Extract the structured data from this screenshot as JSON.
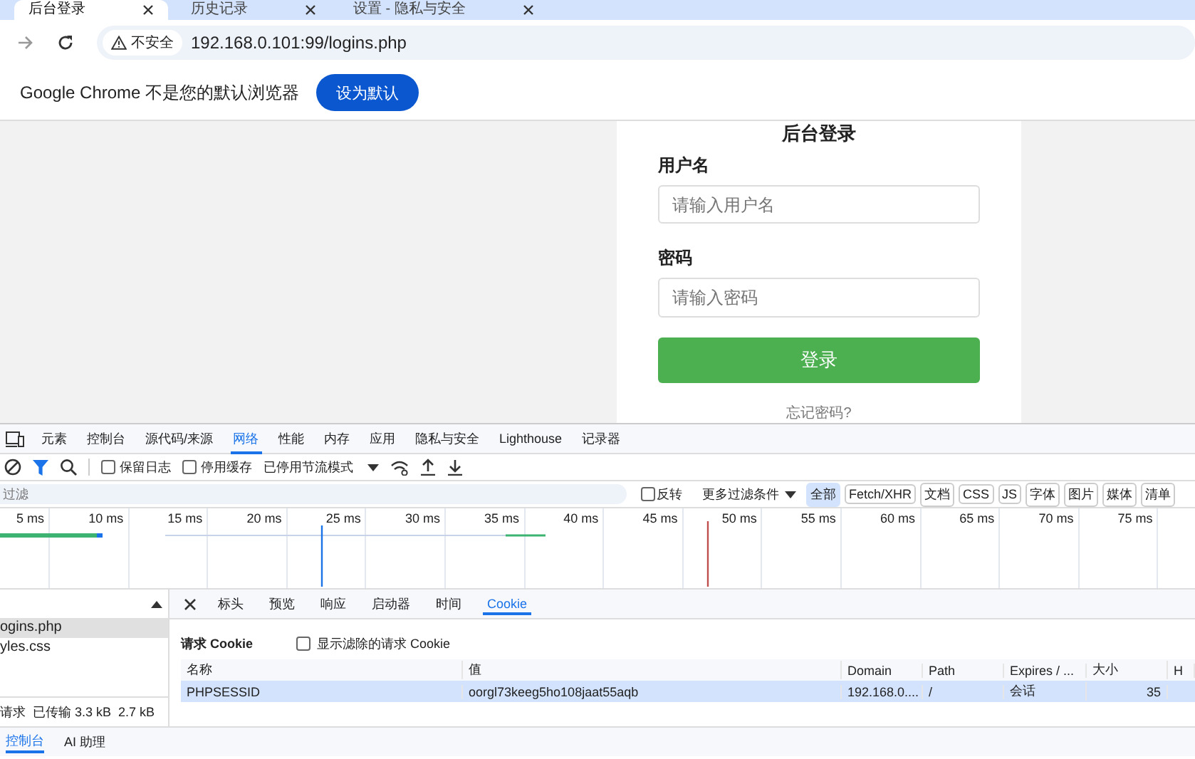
{
  "browser_tabs": [
    {
      "title": "后台登录",
      "selected": true
    },
    {
      "title": "历史记录",
      "selected": false
    },
    {
      "title": "设置 - 隐私与安全",
      "selected": false
    }
  ],
  "address_bar": {
    "security": "不安全",
    "url": "192.168.0.101:99/logins.php"
  },
  "infobar": {
    "message": "Google Chrome 不是您的默认浏览器",
    "button": "设为默认"
  },
  "login_form": {
    "title": "后台登录",
    "fields": [
      {
        "label": "用户名",
        "placeholder": "请输入用户名"
      },
      {
        "label": "密码",
        "placeholder": "请输入密码"
      }
    ],
    "submit": "登录",
    "forgot_link": "忘记密码?"
  },
  "devtools": {
    "panels": [
      {
        "label": "元素",
        "selected": false
      },
      {
        "label": "控制台",
        "selected": false
      },
      {
        "label": "源代码/来源",
        "selected": false
      },
      {
        "label": "网络",
        "selected": true
      },
      {
        "label": "性能",
        "selected": false
      },
      {
        "label": "内存",
        "selected": false
      },
      {
        "label": "应用",
        "selected": false
      },
      {
        "label": "隐私与安全",
        "selected": false
      },
      {
        "label": "Lighthouse",
        "selected": false
      },
      {
        "label": "记录器",
        "selected": false
      }
    ],
    "toolbar": {
      "checkboxes": [
        {
          "label": "保留日志",
          "checked": false
        },
        {
          "label": "停用缓存",
          "checked": false
        }
      ],
      "throttle": "已停用节流模式"
    },
    "filter": {
      "placeholder": "过滤",
      "invert": {
        "label": "反转",
        "checked": false
      },
      "more_filters": "更多过滤条件",
      "types": [
        {
          "label": "全部",
          "selected": true
        },
        {
          "label": "Fetch/XHR",
          "selected": false
        },
        {
          "label": "文档",
          "selected": false
        },
        {
          "label": "CSS",
          "selected": false
        },
        {
          "label": "JS",
          "selected": false
        },
        {
          "label": "字体",
          "selected": false
        },
        {
          "label": "图片",
          "selected": false
        },
        {
          "label": "媒体",
          "selected": false
        },
        {
          "label": "清单",
          "selected": false
        }
      ]
    },
    "timeline_ticks": [
      "5 ms",
      "10 ms",
      "15 ms",
      "20 ms",
      "25 ms",
      "30 ms",
      "35 ms",
      "40 ms",
      "45 ms",
      "50 ms",
      "55 ms",
      "60 ms",
      "65 ms",
      "70 ms",
      "75 ms"
    ],
    "requests": [
      {
        "name": "ogins.php",
        "selected": true
      },
      {
        "name": "yles.css",
        "selected": false
      }
    ],
    "summary": [
      "请求",
      "已传输 3.3 kB",
      "2.7 kB"
    ],
    "detail_tabs": [
      {
        "label": "标头",
        "selected": false
      },
      {
        "label": "预览",
        "selected": false
      },
      {
        "label": "响应",
        "selected": false
      },
      {
        "label": "启动器",
        "selected": false
      },
      {
        "label": "时间",
        "selected": false
      },
      {
        "label": "Cookie",
        "selected": true
      }
    ],
    "cookies": {
      "title": "请求 Cookie",
      "show_filtered": {
        "label": "显示滤除的请求 Cookie",
        "checked": false
      },
      "columns": [
        "名称",
        "值",
        "Domain",
        "Path",
        "Expires / ...",
        "大小",
        "H"
      ],
      "rows": [
        {
          "cells": [
            "PHPSESSID",
            "oorgl73keeg5ho108jaat55aqb",
            "192.168.0....",
            "/",
            "会话",
            "35"
          ],
          "selected": true
        }
      ]
    },
    "drawer_tabs": [
      {
        "label": "控制台",
        "selected": true
      },
      {
        "label": "AI 助理",
        "selected": false
      }
    ]
  }
}
